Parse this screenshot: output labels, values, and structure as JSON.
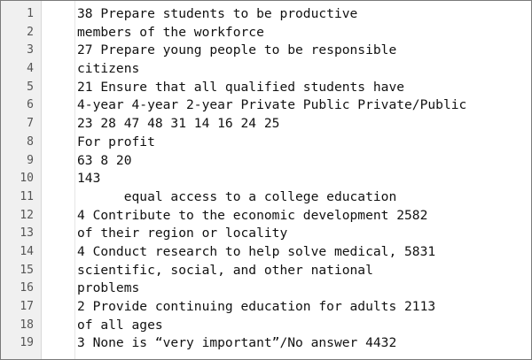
{
  "editor": {
    "line_numbers": [
      "1",
      "2",
      "3",
      "4",
      "5",
      "6",
      "7",
      "8",
      "9",
      "10",
      "11",
      "12",
      "13",
      "14",
      "15",
      "16",
      "17",
      "18",
      "19"
    ],
    "lines": [
      "38 Prepare students to be productive",
      "members of the workforce",
      "27 Prepare young people to be responsible",
      "citizens",
      "21 Ensure that all qualified students have",
      "4-year 4-year 2-year Private Public Private/Public",
      "23 28 47 48 31 14 16 24 25",
      "For profit",
      "63 8 20",
      "143",
      "      equal access to a college education",
      "4 Contribute to the economic development 2582",
      "of their region or locality",
      "4 Conduct research to help solve medical, 5831",
      "scientific, social, and other national",
      "problems",
      "2 Provide continuing education for adults 2113",
      "of all ages",
      "3 None is “very important”/No answer 4432"
    ]
  }
}
